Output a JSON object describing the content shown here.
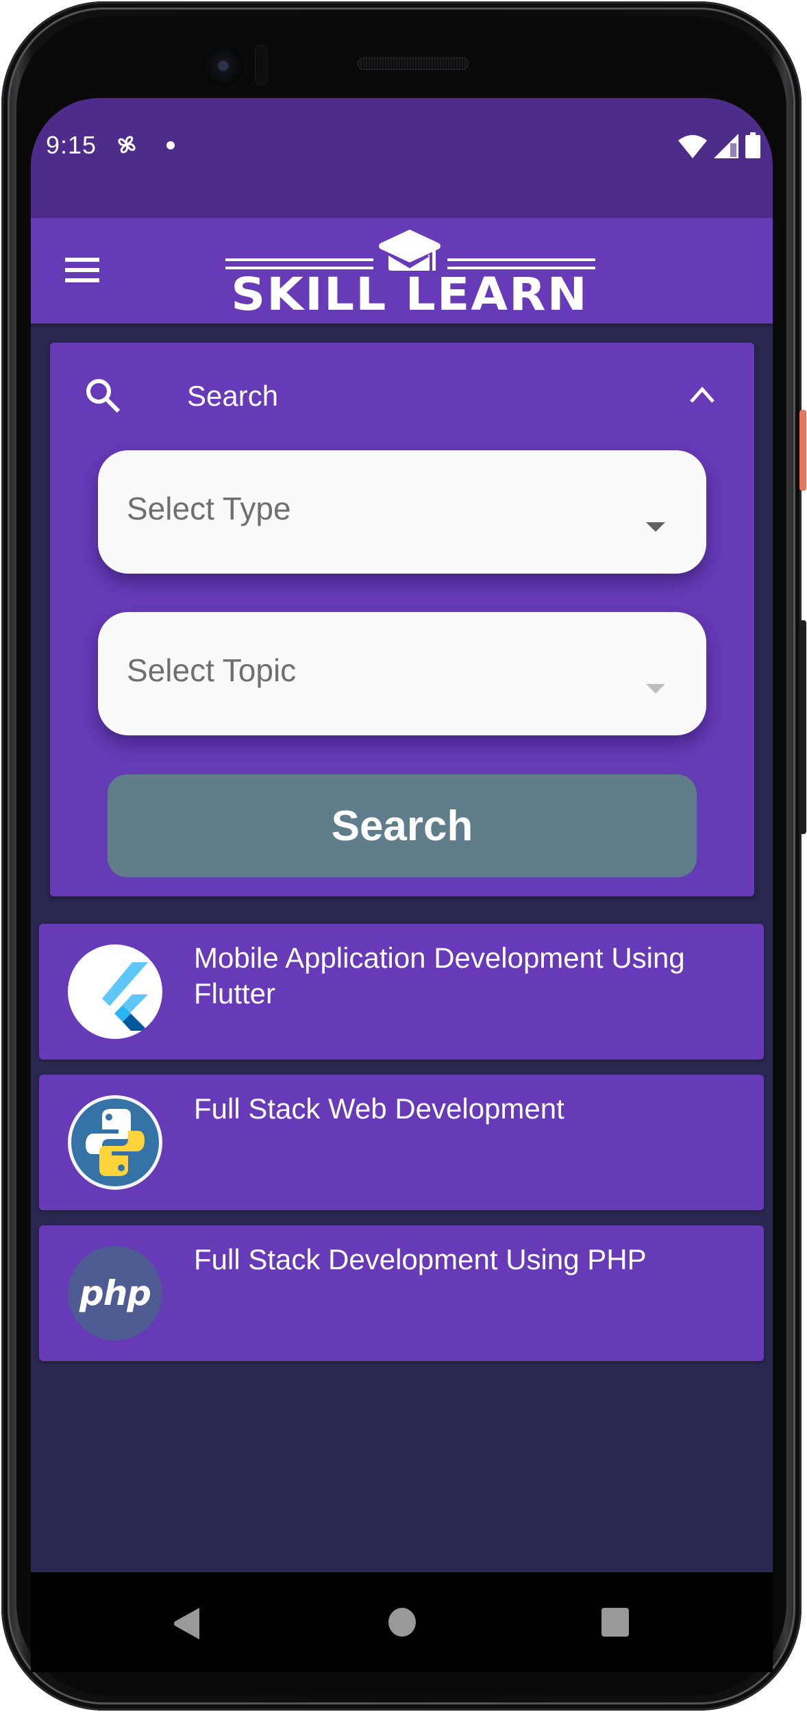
{
  "status_bar": {
    "time": "9:15",
    "icons": [
      "fan-notification-icon",
      "notification-dot-icon",
      "wifi-icon",
      "signal-icon",
      "battery-icon"
    ]
  },
  "app_bar": {
    "menu_icon": "hamburger-menu-icon",
    "logo_text": "SKILL LEARN",
    "logo_icon": "graduation-cap-icon"
  },
  "search_panel": {
    "title": "Search",
    "search_icon": "search-icon",
    "collapse_icon": "chevron-up-icon",
    "type_select": {
      "placeholder": "Select Type",
      "enabled": true
    },
    "topic_select": {
      "placeholder": "Select Topic",
      "enabled": false
    },
    "search_button_label": "Search",
    "search_button_color": "#607D8B"
  },
  "courses": [
    {
      "title": "Mobile Application Development Using Flutter",
      "icon": "flutter-logo-icon"
    },
    {
      "title": "Full Stack Web Development",
      "icon": "python-logo-icon"
    },
    {
      "title": "Full Stack Development Using PHP",
      "icon": "php-logo-icon",
      "icon_text": "php"
    }
  ],
  "nav_bar": {
    "back_icon": "back-triangle-icon",
    "home_icon": "home-circle-icon",
    "recents_icon": "recents-square-icon"
  },
  "colors": {
    "primary": "#673AB7",
    "status_bar": "#4E2C8A",
    "background": "#2A2750",
    "select_bg": "#FAFAFA"
  }
}
